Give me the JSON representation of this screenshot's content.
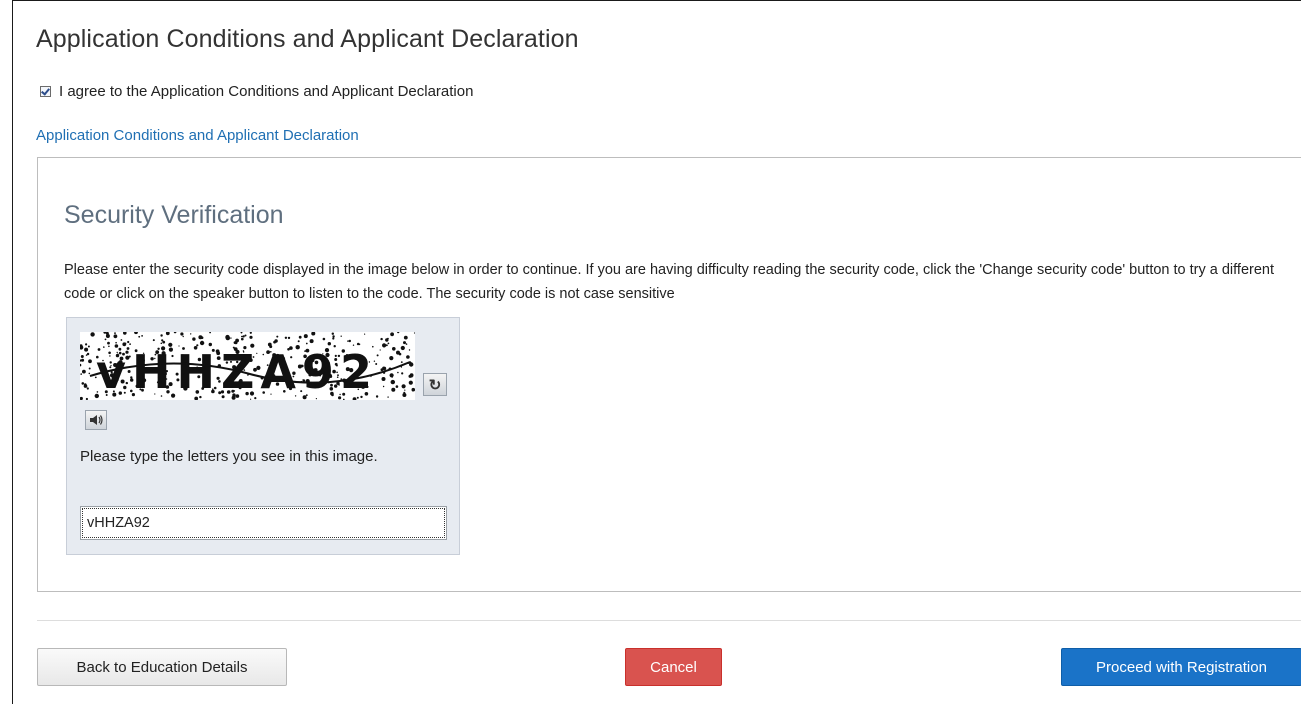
{
  "declaration": {
    "title": "Application Conditions and Applicant Declaration",
    "agree_label": "I agree to the Application Conditions and Applicant Declaration",
    "agree_checked": true,
    "link_text": "Application Conditions and Applicant Declaration"
  },
  "security": {
    "title": "Security Verification",
    "instructions": "Please enter the security code displayed in the image below in order to continue. If you are having difficulty reading the security code, click the 'Change security code' button to try a different code or click on the speaker button to listen to the code. The security code is not case sensitive",
    "captcha_text": "vHHZA92",
    "prompt": "Please type the letters you see in this image.",
    "input_value": "vHHZA92"
  },
  "icons": {
    "refresh": "refresh-icon",
    "audio": "speaker-icon"
  },
  "actions": {
    "back_label": "Back to Education Details",
    "cancel_label": "Cancel",
    "proceed_label": "Proceed with Registration"
  },
  "colors": {
    "link": "#1f6fb3",
    "cancel": "#d9534f",
    "proceed": "#1a73c8"
  }
}
